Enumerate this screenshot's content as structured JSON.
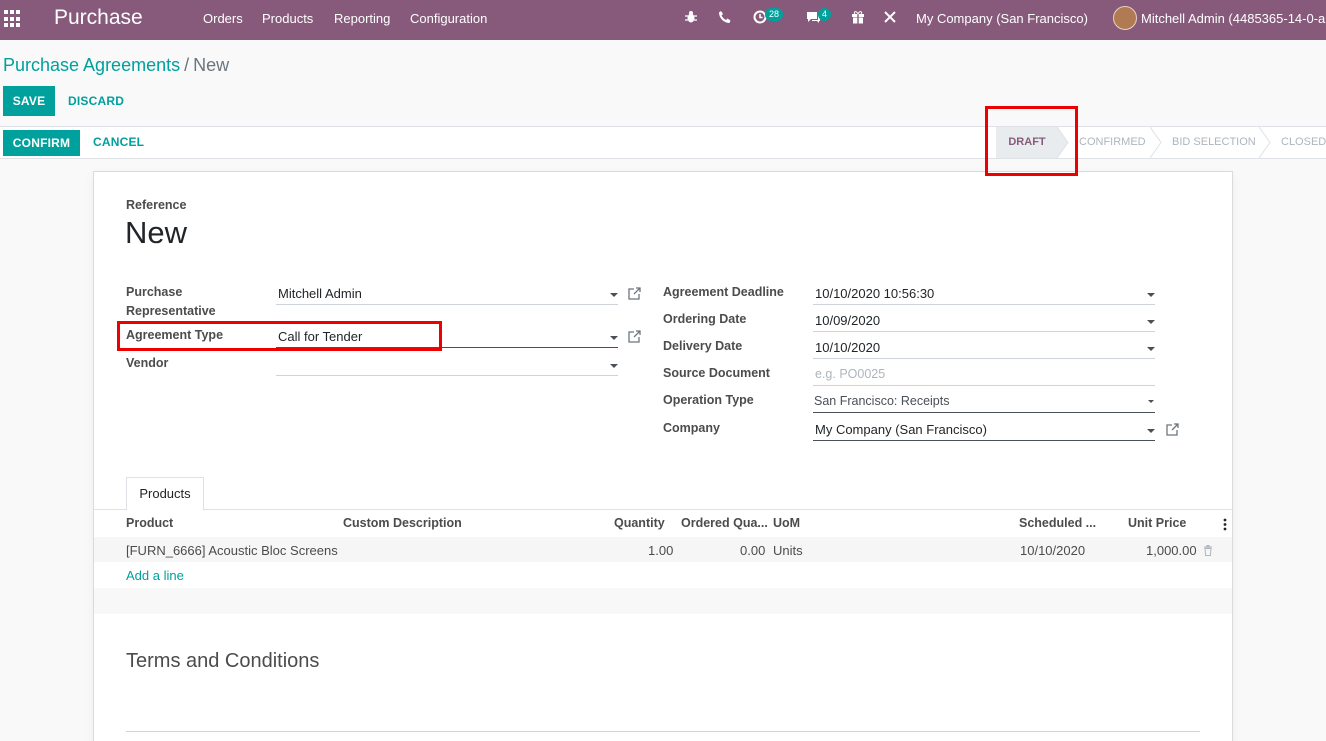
{
  "topnav": {
    "app_title": "Purchase",
    "menu": [
      "Orders",
      "Products",
      "Reporting",
      "Configuration"
    ],
    "activity_count": "28",
    "message_count": "4",
    "company": "My Company (San Francisco)",
    "user": "Mitchell Admin (4485365-14-0-a",
    "bar_color": "#875a7b"
  },
  "breadcrumb": {
    "parent": "Purchase Agreements",
    "separator": "/",
    "current": "New"
  },
  "actions": {
    "save": "SAVE",
    "discard": "DISCARD",
    "confirm": "CONFIRM",
    "cancel": "CANCEL"
  },
  "statusbar": {
    "stages": [
      "DRAFT",
      "CONFIRMED",
      "BID SELECTION",
      "CLOSED"
    ],
    "active": "DRAFT"
  },
  "form": {
    "reference_label": "Reference",
    "reference_value": "New",
    "left": {
      "purchase_rep_label_1": "Purchase",
      "purchase_rep_label_2": "Representative",
      "purchase_rep_value": "Mitchell Admin",
      "agreement_type_label": "Agreement Type",
      "agreement_type_value": "Call for Tender",
      "vendor_label": "Vendor",
      "vendor_value": ""
    },
    "right": {
      "deadline_label": "Agreement Deadline",
      "deadline_value": "10/10/2020 10:56:30",
      "ordering_date_label": "Ordering Date",
      "ordering_date_value": "10/09/2020",
      "delivery_date_label": "Delivery Date",
      "delivery_date_value": "10/10/2020",
      "source_doc_label": "Source Document",
      "source_doc_placeholder": "e.g. PO0025",
      "operation_type_label": "Operation Type",
      "operation_type_value": "San Francisco: Receipts",
      "company_label": "Company",
      "company_value": "My Company (San Francisco)"
    }
  },
  "tabs": {
    "products": "Products"
  },
  "table": {
    "headers": [
      "Product",
      "Custom Description",
      "Quantity",
      "Ordered Qua...",
      "UoM",
      "Scheduled ...",
      "Unit Price"
    ],
    "rows": [
      {
        "product": "[FURN_6666] Acoustic Bloc Screens",
        "custom_description": "",
        "quantity": "1.00",
        "ordered_qty": "0.00",
        "uom": "Units",
        "scheduled": "10/10/2020",
        "unit_price": "1,000.00"
      }
    ],
    "add_line": "Add a line"
  },
  "terms_title": "Terms and Conditions",
  "accent_color": "#00a09d"
}
